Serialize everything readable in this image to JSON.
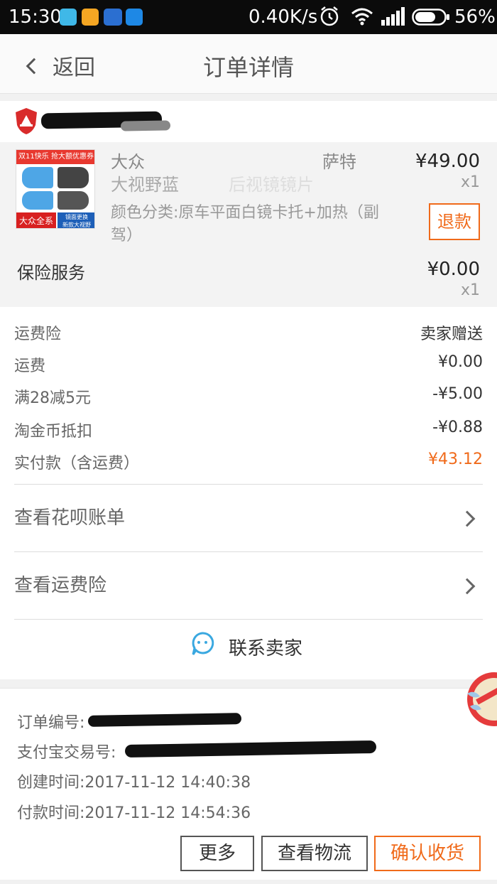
{
  "status_bar": {
    "time": "15:30",
    "speed": "0.40K/s",
    "battery": "56%",
    "app_icons": [
      "#3fb8e8",
      "#f5a623",
      "#2b6fd1",
      "#1e88e5"
    ]
  },
  "header": {
    "back_label": "返回",
    "title": "订单详情"
  },
  "goods": {
    "title_line1_start": "大众",
    "title_line1_end": "萨特",
    "title_line2": "大视野蓝",
    "title_line2_end": "后视镜镜片",
    "sku": "颜色分类:原车平面白镜卡托+加热（副驾）",
    "price": "¥49.00",
    "qty": "x1",
    "refund_label": "退款",
    "thumb_banner": "双11快乐 抢大额优惠券",
    "thumb_tag": "大众全系",
    "thumb_note1": "镜面更换",
    "thumb_note2": "新款大视野"
  },
  "insurance": {
    "label": "保险服务",
    "price": "¥0.00",
    "qty": "x1"
  },
  "fees": [
    {
      "label": "运费险",
      "value": "卖家赠送"
    },
    {
      "label": "运费",
      "value": "¥0.00"
    },
    {
      "label": "满28减5元",
      "value": "-¥5.00"
    },
    {
      "label": "淘金币抵扣",
      "value": "-¥0.88"
    },
    {
      "label": "实付款（含运费）",
      "value": "¥43.12"
    }
  ],
  "links": {
    "huabei": "查看花呗账单",
    "freight_insurance": "查看运费险"
  },
  "contact": {
    "label": "联系卖家"
  },
  "order_info": {
    "order_no_label": "订单编号:",
    "alipay_no_label": "支付宝交易号:",
    "created_label": "创建时间:",
    "created_value": "2017-11-12 14:40:38",
    "paid_label": "付款时间:",
    "paid_value": "2017-11-12 14:54:36"
  },
  "actions": {
    "more": "更多",
    "logistics": "查看物流",
    "confirm": "确认收货"
  },
  "colors": {
    "accent": "#f06a1a",
    "contact_icon": "#3aa8e0"
  }
}
